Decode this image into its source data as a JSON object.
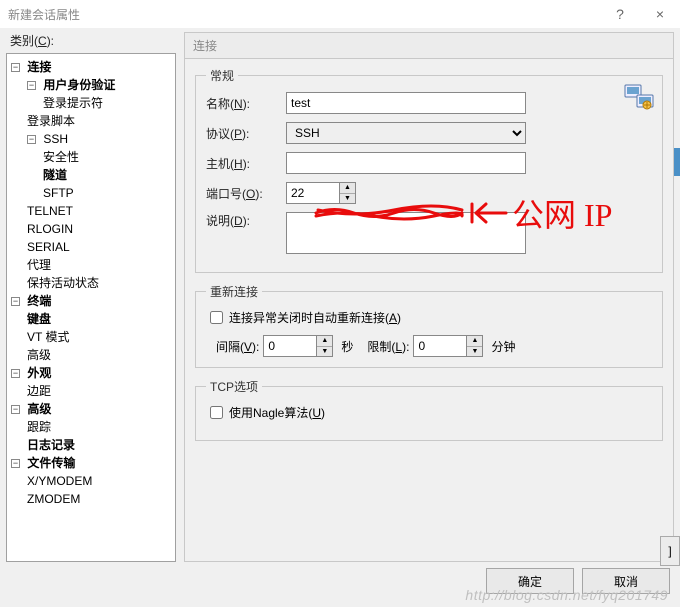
{
  "window": {
    "title": "新建会话属性",
    "help": "?",
    "close": "×"
  },
  "category_label": "类别",
  "category_hotkey": "C",
  "tree": {
    "connection": "连接",
    "user_auth": "用户身份验证",
    "login_prompt": "登录提示符",
    "login_script": "登录脚本",
    "ssh": "SSH",
    "security": "安全性",
    "tunnel": "隧道",
    "sftp": "SFTP",
    "telnet": "TELNET",
    "rlogin": "RLOGIN",
    "serial": "SERIAL",
    "proxy": "代理",
    "keepalive": "保持活动状态",
    "terminal": "终端",
    "keyboard": "键盘",
    "vtmode": "VT 模式",
    "advanced_term": "高级",
    "appearance": "外观",
    "margin": "边距",
    "advanced": "高级",
    "trace": "跟踪",
    "logging": "日志记录",
    "filetransfer": "文件传输",
    "xymodem": "X/YMODEM",
    "zmodem": "ZMODEM"
  },
  "panel": {
    "title": "连接",
    "general_legend": "常规",
    "name_label": "名称",
    "name_hotkey": "N",
    "name_value": "test",
    "protocol_label": "协议",
    "protocol_hotkey": "P",
    "protocol_value": "SSH",
    "host_label": "主机",
    "host_hotkey": "H",
    "host_value": "",
    "port_label": "端口号",
    "port_hotkey": "O",
    "port_value": "22",
    "desc_label": "说明",
    "desc_hotkey": "D",
    "desc_value": "",
    "reconnect_legend": "重新连接",
    "auto_reconnect_label": "连接异常关闭时自动重新连接",
    "auto_reconnect_hotkey": "A",
    "auto_reconnect_checked": false,
    "interval_label": "间隔",
    "interval_hotkey": "V",
    "interval_value": "0",
    "interval_unit": "秒",
    "limit_label": "限制",
    "limit_hotkey": "L",
    "limit_value": "0",
    "limit_unit": "分钟",
    "tcp_legend": "TCP选项",
    "nagle_label": "使用Nagle算法",
    "nagle_hotkey": "U",
    "nagle_checked": false
  },
  "footer": {
    "ok": "确定",
    "cancel": "取消"
  },
  "annotation": "公网 IP",
  "watermark": "http://blog.csdn.net/fyq201749",
  "side_btn": "]"
}
